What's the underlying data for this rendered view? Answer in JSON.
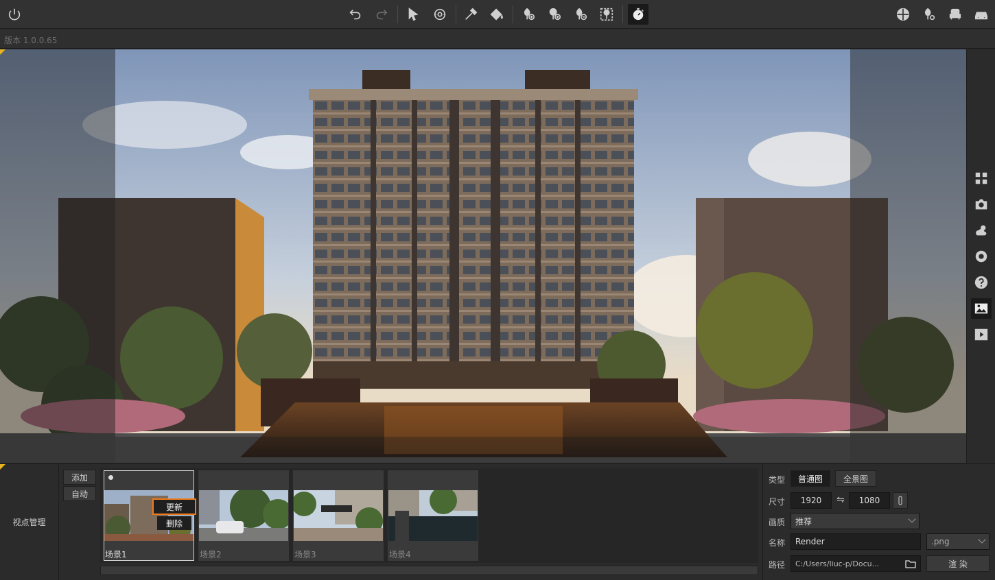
{
  "version_label": "版本 1.0.0.65",
  "viewpoint": {
    "title": "视点管理",
    "add_label": "添加",
    "auto_label": "自动",
    "scenes": [
      {
        "name": "场景1",
        "selected": true
      },
      {
        "name": "场景2",
        "selected": false
      },
      {
        "name": "场景3",
        "selected": false
      },
      {
        "name": "场景4",
        "selected": false
      }
    ],
    "context_menu": {
      "update": "更新",
      "delete": "删除"
    }
  },
  "render": {
    "type_label": "类型",
    "type_normal": "普通图",
    "type_panorama": "全景图",
    "size_label": "尺寸",
    "width": "1920",
    "height": "1080",
    "swap_symbol": "⇋",
    "quality_label": "画质",
    "quality_value": "推荐",
    "name_label": "名称",
    "name_value": "Render",
    "format_value": ".png",
    "path_label": "路径",
    "path_value": "C:/Users/liuc-p/Docu...",
    "render_button": "渲 染"
  },
  "colors": {
    "accent_orange": "#f07a1a",
    "corner_yellow": "#e6b422"
  }
}
